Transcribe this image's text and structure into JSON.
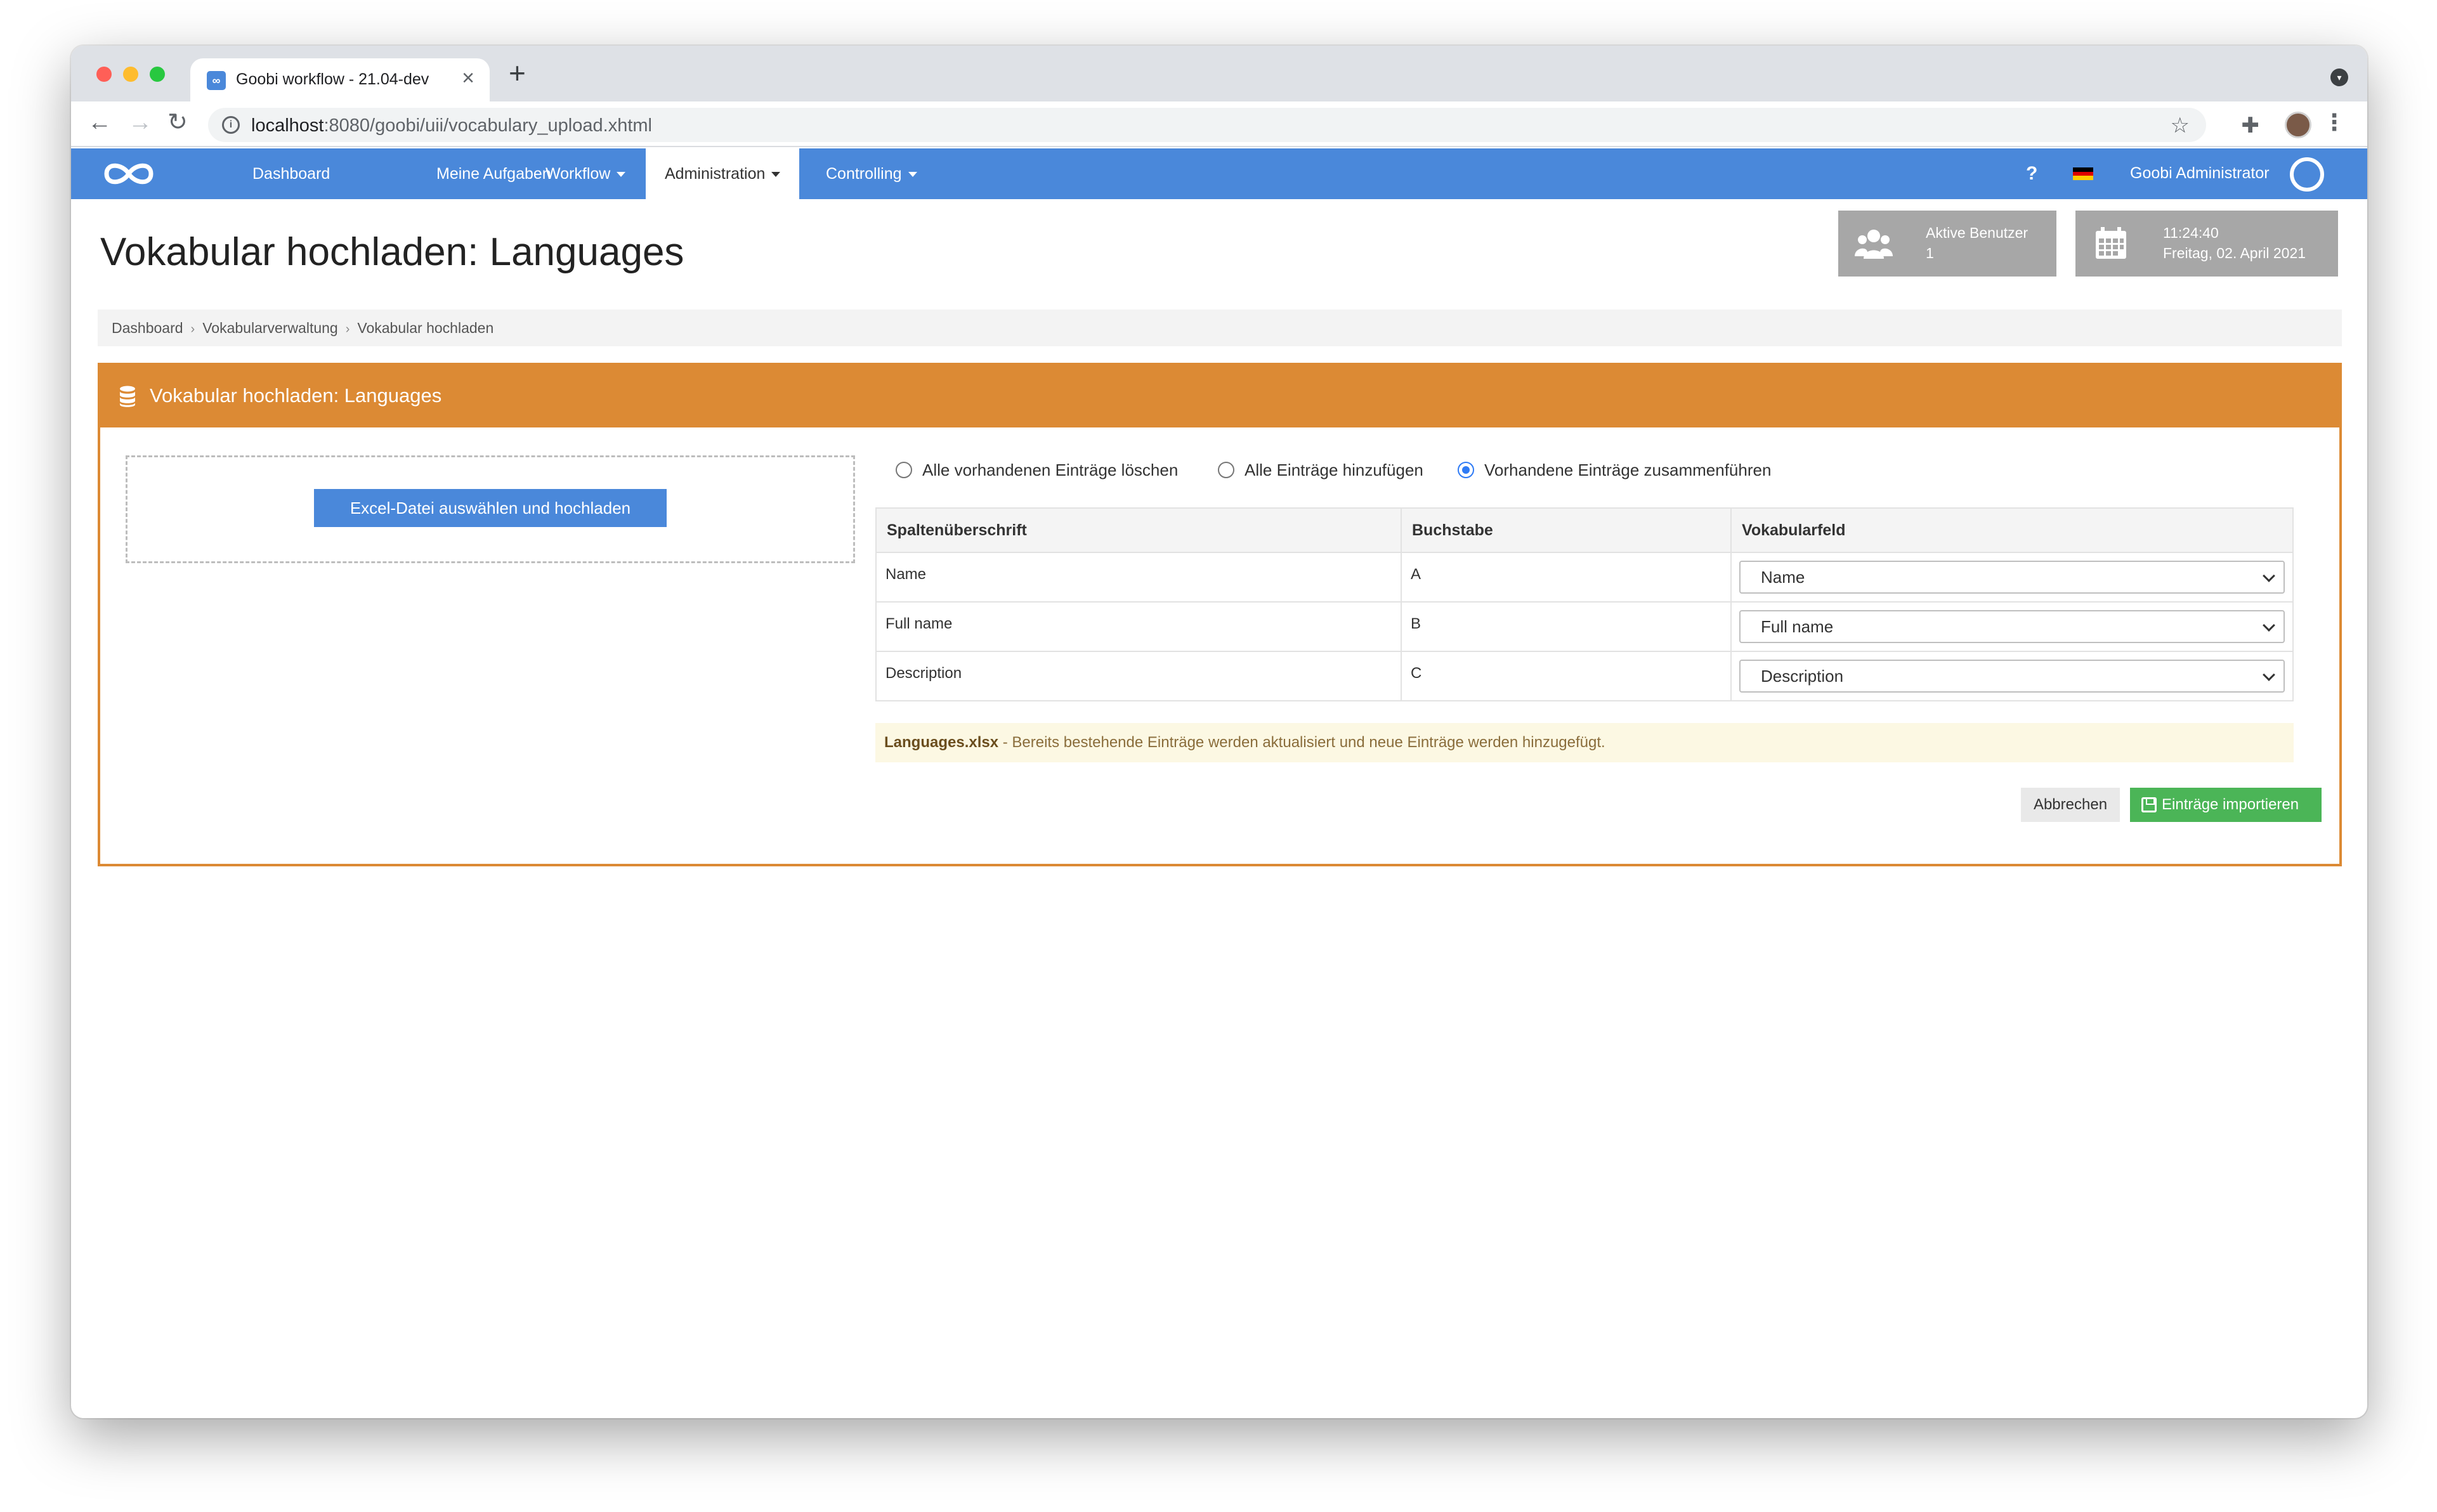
{
  "browser": {
    "tab_title": "Goobi workflow - 21.04-dev",
    "tab_favicon": "∞",
    "url_host": "localhost",
    "url_rest": ":8080/goobi/uii/vocabulary_upload.xhtml"
  },
  "navbar": {
    "items": [
      {
        "label": "Dashboard",
        "dropdown": false
      },
      {
        "label": "Meine Aufgaben",
        "dropdown": false
      },
      {
        "label": "Workflow",
        "dropdown": true
      },
      {
        "label": "Administration",
        "dropdown": true,
        "active": true
      },
      {
        "label": "Controlling",
        "dropdown": true
      }
    ],
    "help_label": "?",
    "user_name": "Goobi Administrator",
    "brand_color": "#4a88da"
  },
  "page": {
    "title": "Vokabular hochladen: Languages"
  },
  "widgets": {
    "users_label": "Aktive Benutzer",
    "users_count": "1",
    "time": "11:24:40",
    "date": "Freitag, 02. April 2021"
  },
  "breadcrumb": [
    "Dashboard",
    "Vokabularverwaltung",
    "Vokabular hochladen"
  ],
  "box": {
    "title": "Vokabular hochladen: Languages",
    "accent_color": "#dc8a34",
    "upload_button": "Excel-Datei auswählen und hochladen",
    "radios": [
      {
        "label": "Alle vorhandenen Einträge löschen",
        "checked": false
      },
      {
        "label": "Alle Einträge hinzufügen",
        "checked": false
      },
      {
        "label": "Vorhandene Einträge zusammenführen",
        "checked": true
      }
    ],
    "table": {
      "headers": [
        "Spaltenüberschrift",
        "Buchstabe",
        "Vokabularfeld"
      ],
      "rows": [
        {
          "heading": "Name",
          "letter": "A",
          "field": "Name"
        },
        {
          "heading": "Full name",
          "letter": "B",
          "field": "Full name"
        },
        {
          "heading": "Description",
          "letter": "C",
          "field": "Description"
        }
      ]
    },
    "notice_file": "Languages.xlsx",
    "notice_text": " - Bereits bestehende Einträge werden aktualisiert und neue Einträge werden hinzugefügt.",
    "cancel_button": "Abbrechen",
    "import_button": "Einträge importieren"
  }
}
